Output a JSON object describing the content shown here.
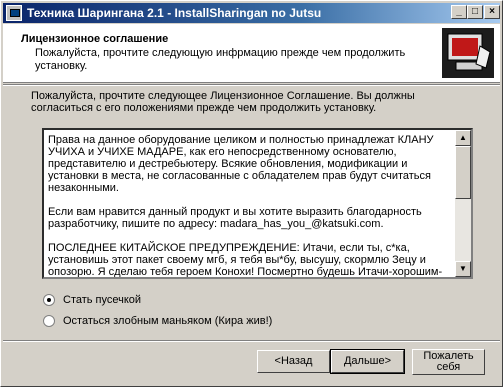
{
  "window": {
    "title": "Техника Шарингана 2.1 - InstallSharingan no Jutsu",
    "minimize_icon": "minimize-icon",
    "maximize_icon": "maximize-icon",
    "close_icon": "close-icon"
  },
  "header": {
    "title": "Лицензионное соглашение",
    "subtitle": "Пожалуйста, прочтите следующую инфрмацию прежде чем продолжить установку."
  },
  "intro": "Пожалуйста, прочтите следующее Лицензионное Соглашение. Вы должны согласиться с его положениями прежде чем продолжить установку.",
  "license": {
    "text": "Права на данное оборудование целиком и полностью принадлежат КЛАНУ УЧИХА и УЧИХЕ МАДАРЕ, как его непосредственному основателю, представителю и дестребьютеру. Всякие обновления, модификации и установки в места, не согласованные с обладателем прав будут считаться незаконными.\n\nЕсли вам нравится данный продукт и вы хотите выразить благодарность разработчику, пишите по адресу: madara_has_you_@katsuki.com.\n\nПОСЛЕДНЕЕ КИТАЙСКОЕ ПРЕДУПРЕЖДЕНИЕ: Итачи, если ты, с*ка, установишь этот пакет своему мгб, я тебя вы*бу, высушу, скормлю Зецу и опозорю. Я сделаю тебя героем Конохи! Посмертно будешь Итачи-хорошим-мальчиком! Подумай об имидже!!!"
  },
  "options": {
    "accept": "Стать пусечкой",
    "decline": "Остаться злобным маньяком (Кира жив!)",
    "selected": "accept"
  },
  "buttons": {
    "back": "<Назад",
    "next": "Дальше>",
    "cancel": "Пожалеть себя"
  }
}
